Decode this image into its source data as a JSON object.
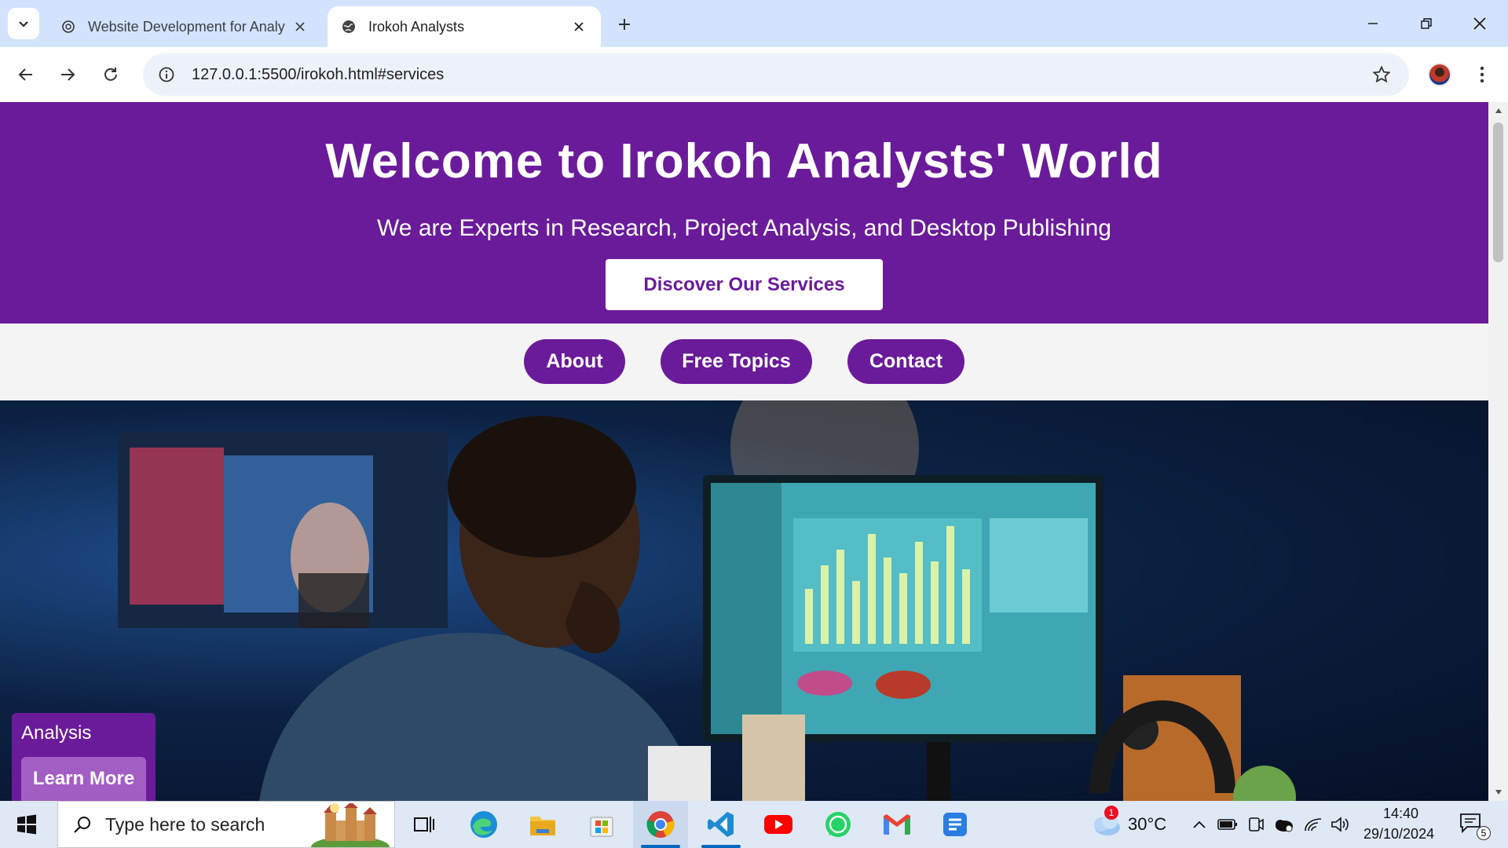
{
  "browser": {
    "tabs": [
      {
        "title": "Website Development for Analy",
        "active": false
      },
      {
        "title": "Irokoh Analysts",
        "active": true
      }
    ],
    "url": "127.0.0.1:5500/irokoh.html#services"
  },
  "page": {
    "hero": {
      "title": "Welcome to Irokoh Analysts' World",
      "subtitle": "We are Experts in Research, Project Analysis, and Desktop Publishing",
      "cta_label": "Discover Our Services"
    },
    "nav": {
      "items": [
        "About",
        "Free Topics",
        "Contact"
      ]
    },
    "service_card": {
      "title": "Analysis",
      "button_label": "Learn More"
    },
    "colors": {
      "brand_purple": "#6a1b9a",
      "card_button": "#a35ec4"
    }
  },
  "taskbar": {
    "search_placeholder": "Type here to search",
    "apps": [
      "task-view",
      "edge",
      "file-explorer",
      "microsoft-store",
      "chrome",
      "vscode",
      "youtube",
      "whatsapp",
      "gmail",
      "docs"
    ],
    "weather": {
      "temp": "30°C",
      "badge": "1"
    },
    "clock": {
      "time": "14:40",
      "date": "29/10/2024"
    },
    "notifications": "5"
  }
}
